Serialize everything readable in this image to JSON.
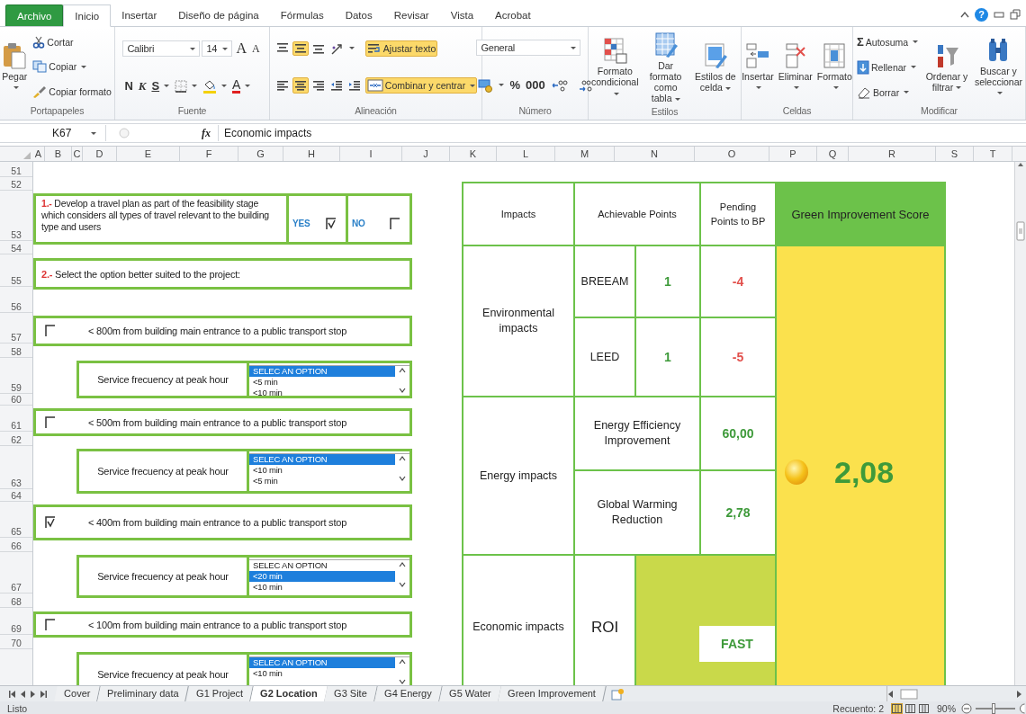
{
  "ribbon_tabs": [
    {
      "label": "Archivo",
      "kind": "file",
      "selected": false
    },
    {
      "label": "Inicio",
      "kind": "tab",
      "selected": true
    },
    {
      "label": "Insertar",
      "kind": "tab",
      "selected": false
    },
    {
      "label": "Diseño de página",
      "kind": "tab",
      "selected": false
    },
    {
      "label": "Fórmulas",
      "kind": "tab",
      "selected": false
    },
    {
      "label": "Datos",
      "kind": "tab",
      "selected": false
    },
    {
      "label": "Revisar",
      "kind": "tab",
      "selected": false
    },
    {
      "label": "Vista",
      "kind": "tab",
      "selected": false
    },
    {
      "label": "Acrobat",
      "kind": "tab",
      "selected": false
    }
  ],
  "window_controls": {
    "help": "?"
  },
  "ribbon_groups": [
    {
      "label": "Portapapeles",
      "columns": [
        [
          [
            {
              "kind": "large",
              "label": "Pegar",
              "dropdown": true
            }
          ]
        ],
        [
          [
            {
              "kind": "small",
              "label": "Cortar"
            }
          ],
          [
            {
              "kind": "small",
              "label": "Copiar",
              "dropdown": true
            }
          ],
          [
            {
              "kind": "small",
              "label": "Copiar formato"
            }
          ]
        ]
      ]
    },
    {
      "label": "Fuente",
      "columns": [
        [
          [
            {
              "kind": "field",
              "value": "Calibri"
            },
            {
              "kind": "field",
              "value": "14"
            },
            {
              "kind": "grow",
              "label": "A",
              "on": false
            },
            {
              "kind": "shrink",
              "label": "A",
              "on": false
            }
          ],
          [
            {
              "kind": "bold",
              "label": "N",
              "on": false
            },
            {
              "kind": "italic",
              "label": "K",
              "on": false
            },
            {
              "kind": "underline",
              "label": "S",
              "dropdown": true,
              "on": false
            },
            {
              "kind": "icon",
              "dropdown": true,
              "on": false
            },
            {
              "kind": "icon",
              "dropdown": true,
              "on": false
            },
            {
              "kind": "font-color",
              "label": "A",
              "dropdown": true,
              "on": false
            }
          ]
        ]
      ]
    },
    {
      "label": "Alineación",
      "columns": [
        [
          [
            {
              "kind": "icon",
              "on": false
            },
            {
              "kind": "icon",
              "on": true
            },
            {
              "kind": "icon",
              "on": false
            },
            {
              "kind": "icon",
              "dropdown": true,
              "on": false
            }
          ],
          [
            {
              "kind": "icon",
              "on": false
            },
            {
              "kind": "icon",
              "on": true
            },
            {
              "kind": "icon",
              "on": false
            },
            {
              "kind": "icon",
              "on": false
            },
            {
              "kind": "icon",
              "on": false
            }
          ]
        ],
        [
          [
            {
              "kind": "toggle",
              "label": "Ajustar texto",
              "on": true
            }
          ],
          [
            {
              "kind": "toggle",
              "label": "Combinar y centrar",
              "dropdown": true,
              "on": true
            }
          ]
        ]
      ]
    },
    {
      "label": "Número",
      "columns": [
        [
          [
            {
              "kind": "field",
              "value": "General"
            }
          ],
          [
            {
              "kind": "icon",
              "dropdown": true,
              "on": false
            },
            {
              "kind": "text",
              "label": "%",
              "on": false
            },
            {
              "kind": "text",
              "label": "000",
              "on": false
            },
            {
              "kind": "icon",
              "on": false
            },
            {
              "kind": "icon",
              "on": false
            }
          ]
        ]
      ]
    },
    {
      "label": "Estilos",
      "columns": [
        [
          [
            {
              "kind": "large",
              "label": "Formato condicional",
              "dropdown": true
            }
          ]
        ],
        [
          [
            {
              "kind": "large",
              "label": "Dar formato como tabla",
              "dropdown": true
            }
          ]
        ],
        [
          [
            {
              "kind": "large",
              "label": "Estilos de celda",
              "dropdown": true
            }
          ]
        ]
      ]
    },
    {
      "label": "Celdas",
      "columns": [
        [
          [
            {
              "kind": "large",
              "label": "Insertar",
              "dropdown": true
            }
          ]
        ],
        [
          [
            {
              "kind": "large",
              "label": "Eliminar",
              "dropdown": true
            }
          ]
        ],
        [
          [
            {
              "kind": "large",
              "label": "Formato",
              "dropdown": true
            }
          ]
        ]
      ]
    },
    {
      "label": "Modificar",
      "columns": [
        [
          [
            {
              "kind": "small",
              "glyph": "Σ",
              "label": "Autosuma",
              "dropdown": true
            }
          ],
          [
            {
              "kind": "small",
              "label": "Rellenar",
              "dropdown": true
            }
          ],
          [
            {
              "kind": "small",
              "label": "Borrar",
              "dropdown": true
            }
          ]
        ],
        [
          [
            {
              "kind": "large",
              "label": "Ordenar y filtrar",
              "dropdown": true
            }
          ]
        ],
        [
          [
            {
              "kind": "large",
              "label": "Buscar y seleccionar",
              "dropdown": true
            }
          ]
        ]
      ]
    }
  ],
  "formula_bar": {
    "cell": "K67",
    "function_label": "fx",
    "formula": "Economic impacts"
  },
  "columns": [
    "A",
    "B",
    "C",
    "D",
    "E",
    "F",
    "G",
    "H",
    "I",
    "J",
    "K",
    "L",
    "M",
    "N",
    "O",
    "P",
    "Q",
    "R",
    "S",
    "T"
  ],
  "rows": [
    "51",
    "52",
    "53",
    "54",
    "55",
    "56",
    "57",
    "58",
    "59",
    "60",
    "61",
    "62",
    "63",
    "64",
    "65",
    "66",
    "67",
    "68",
    "69",
    "70"
  ],
  "travel_plan": {
    "number": "1.-",
    "question": "Develop a travel plan as part of the feasibility stage which considers all types of travel relevant to the building type and users",
    "options": [
      {
        "label": "YES",
        "checked": true
      },
      {
        "label": "NO",
        "checked": false
      }
    ]
  },
  "selection": {
    "number": "2.-",
    "prompt": "Select the option better suited to the project:"
  },
  "distance_options": [
    {
      "label": "< 800m from building main entrance to a public transport stop",
      "checked": false,
      "frequency": {
        "label": "Service frecuency at peak hour",
        "items": [
          {
            "text": "SELEC AN OPTION",
            "selected": true
          },
          {
            "text": "<5 min",
            "selected": false
          },
          {
            "text": "<10 min",
            "selected": false
          }
        ]
      }
    },
    {
      "label": "< 500m from building main entrance to a public transport stop",
      "checked": false,
      "frequency": {
        "label": "Service frecuency at peak hour",
        "items": [
          {
            "text": "SELEC AN OPTION",
            "selected": true
          },
          {
            "text": "<10 min",
            "selected": false
          },
          {
            "text": "<5 min",
            "selected": false
          }
        ]
      }
    },
    {
      "label": "< 400m from building main entrance to a public transport stop",
      "checked": true,
      "frequency": {
        "label": "Service frecuency at peak hour",
        "items": [
          {
            "text": "SELEC AN OPTION",
            "selected": false
          },
          {
            "text": "<20 min",
            "selected": true
          },
          {
            "text": "<10 min",
            "selected": false
          }
        ]
      }
    },
    {
      "label": "< 100m from building main entrance to a public transport stop",
      "checked": false,
      "frequency": {
        "label": "Service frecuency at peak hour",
        "items": [
          {
            "text": "SELEC AN OPTION",
            "selected": true
          },
          {
            "text": "<10 min",
            "selected": false
          }
        ]
      }
    }
  ],
  "score_table": {
    "headers": [
      "Impacts",
      "Achievable Points",
      "Pending Points to BP",
      "Green Improvement Score"
    ],
    "groups": [
      {
        "impact": "Environmental impacts",
        "rows": [
          {
            "kind": "points",
            "label": "BREEAM",
            "points": "1",
            "pending": "-4",
            "color": "#e2504c"
          },
          {
            "kind": "points",
            "label": "LEED",
            "points": "1",
            "pending": "-5",
            "color": "#e2504c"
          }
        ]
      },
      {
        "impact": "Energy impacts",
        "rows": [
          {
            "kind": "measure",
            "label": "Energy Efficiency Improvement",
            "pending": "60,00",
            "color": "#3e9a3a"
          },
          {
            "kind": "measure",
            "label": "Global Warming Reduction",
            "pending": "2,78",
            "color": "#3e9a3a"
          }
        ]
      },
      {
        "impact": "Economic impacts",
        "rows": [
          {
            "kind": "rating",
            "label": "ROI",
            "pending": "FAST",
            "color": "#3e9a3a"
          }
        ]
      }
    ],
    "score": "2,08"
  },
  "sheet_tabs": [
    {
      "label": "Cover",
      "selected": false
    },
    {
      "label": "Preliminary data",
      "selected": false
    },
    {
      "label": "G1 Project",
      "selected": false
    },
    {
      "label": "G2 Location",
      "selected": true
    },
    {
      "label": "G3 Site",
      "selected": false
    },
    {
      "label": "G4 Energy",
      "selected": false
    },
    {
      "label": "G5 Water",
      "selected": false
    },
    {
      "label": "Green Improvement",
      "selected": false
    }
  ],
  "status_bar": {
    "status": "Listo",
    "count": "Recuento: 2",
    "views": [
      {
        "selected": true
      },
      {
        "selected": false
      },
      {
        "selected": false
      }
    ],
    "zoom": "90%",
    "zoom_slider": {
      "level": 0.45
    }
  }
}
